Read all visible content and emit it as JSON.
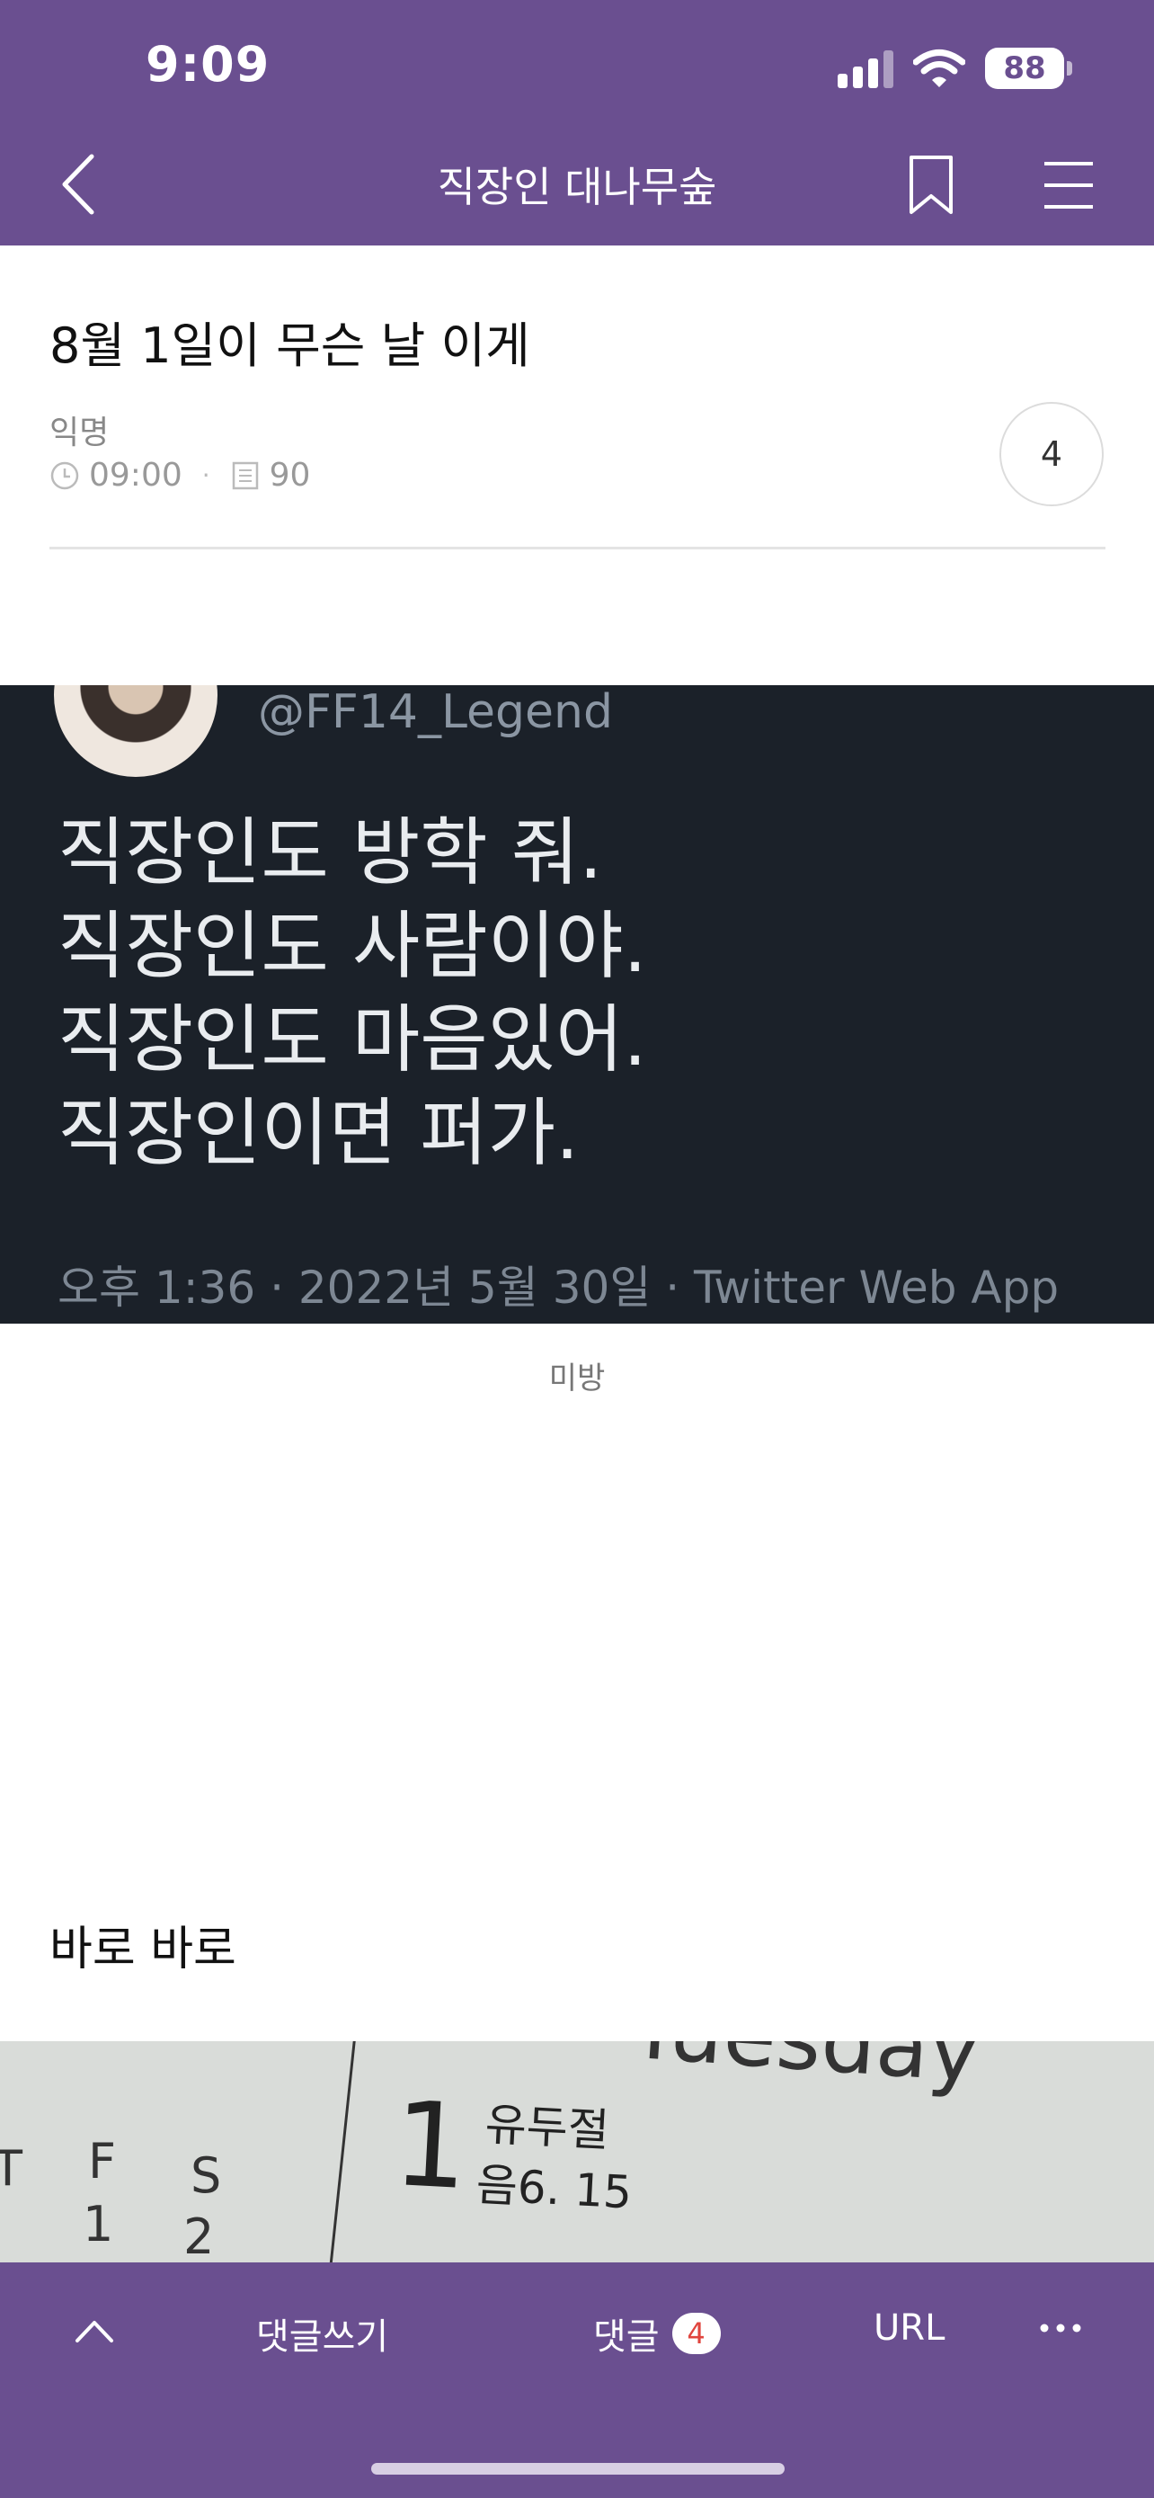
{
  "status_bar": {
    "time": "9:09",
    "battery": "88"
  },
  "nav": {
    "title": "직장인 대나무숲"
  },
  "post": {
    "title": "8월 1일이 무슨 날 이게",
    "author": "익명",
    "time": "09:00",
    "views": "90",
    "comment_count": "4"
  },
  "tweet_image": {
    "handle": "@FF14_Legend",
    "lines": [
      "직장인도 방학 줘.",
      "직장인도 사람이야.",
      "직장인도 마음있어.",
      "직장인이면 퍼가."
    ],
    "footer": "오후 1:36 · 2022년 5월 30일 · Twitter Web App"
  },
  "image_caption": "미방",
  "body_text": "바로 바로",
  "calendar_image": {
    "day_name": "Tuesday",
    "date": "1",
    "holiday": "유두절",
    "lunar": "음6. 15",
    "week_letters": [
      "T",
      "F",
      "S"
    ],
    "week_numbers": [
      "1",
      "2"
    ]
  },
  "bottom_bar": {
    "write_comment": "댓글쓰기",
    "comments_label": "댓글",
    "comments_count": "4",
    "url_label": "URL"
  },
  "colors": {
    "brand": "#6a4f90",
    "badge_text": "#e0453e"
  },
  "icons": [
    "back-icon",
    "bookmark-icon",
    "menu-icon",
    "clock-icon",
    "document-icon",
    "chevron-up-icon",
    "more-icon"
  ]
}
